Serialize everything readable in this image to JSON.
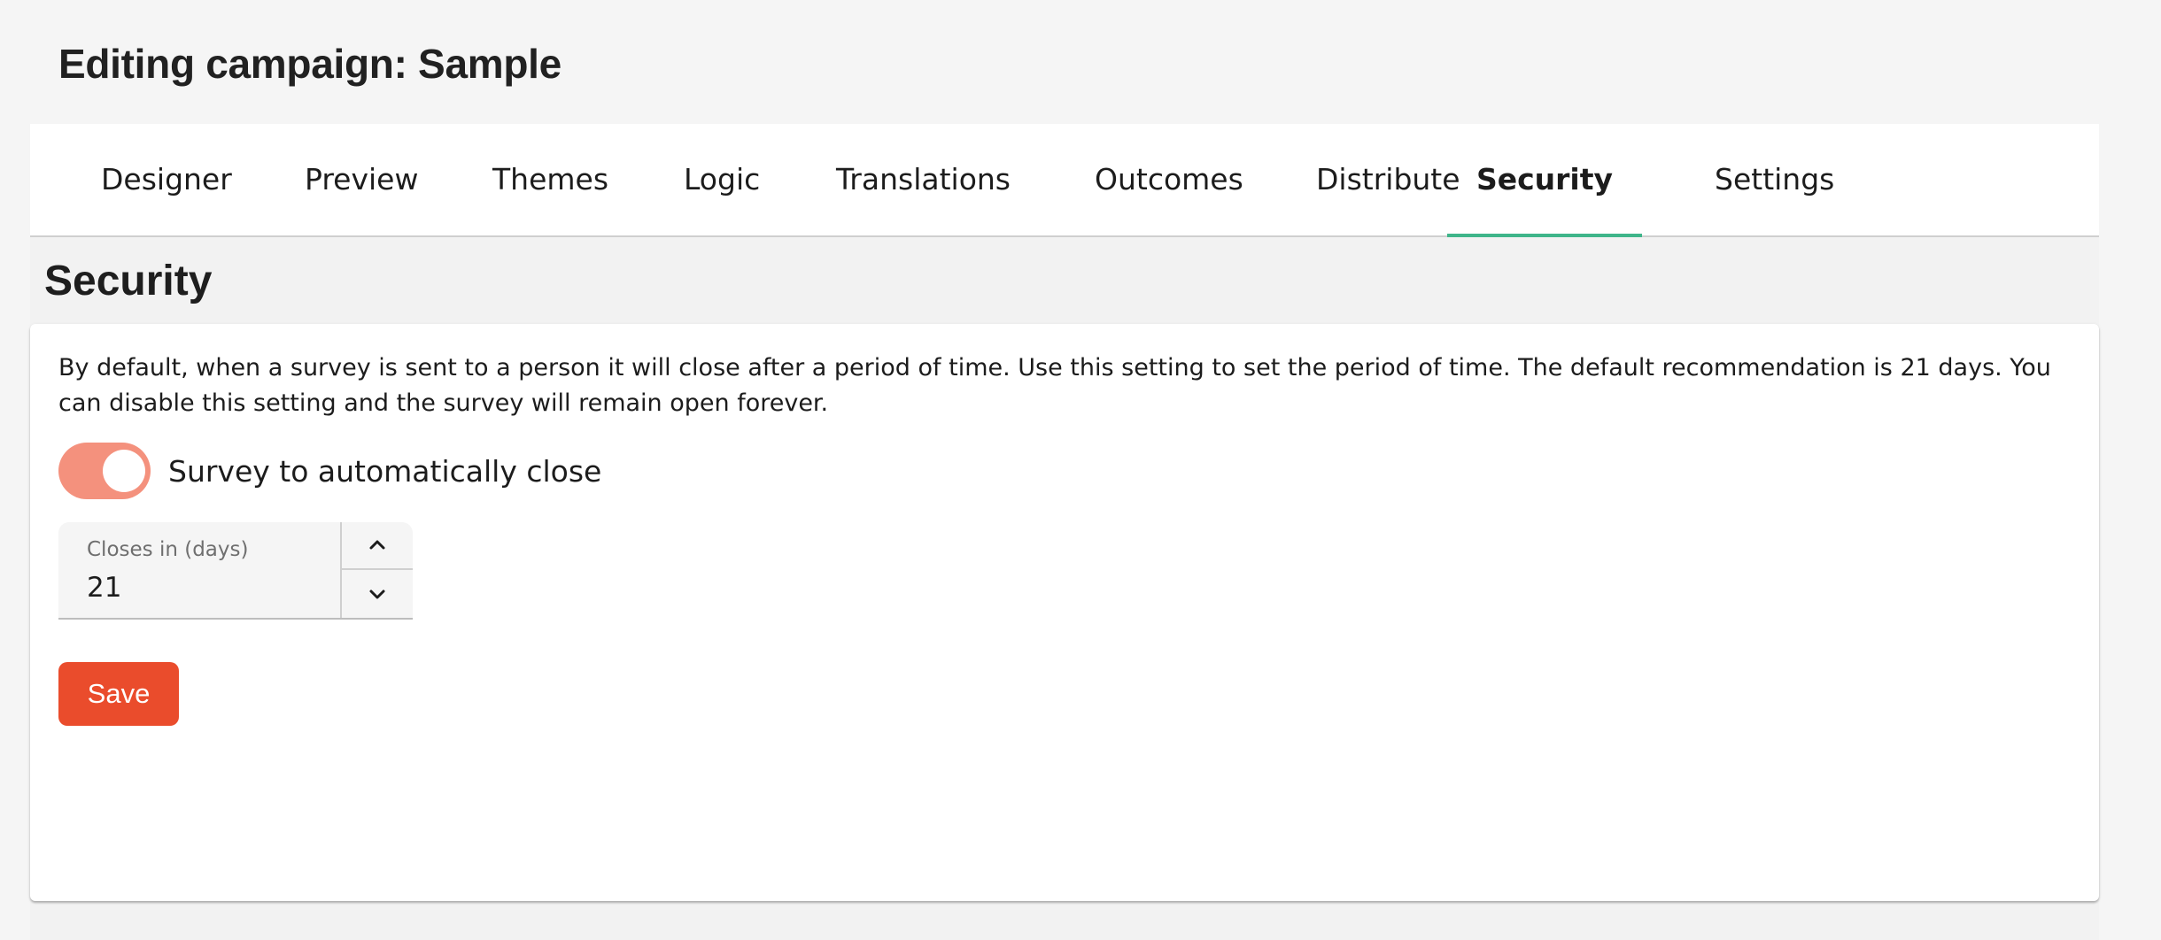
{
  "header": {
    "title": "Editing campaign: Sample"
  },
  "tabs": [
    {
      "label": "Designer",
      "active": false
    },
    {
      "label": "Preview",
      "active": false
    },
    {
      "label": "Themes",
      "active": false
    },
    {
      "label": "Logic",
      "active": false
    },
    {
      "label": "Translations",
      "active": false
    },
    {
      "label": "Outcomes",
      "active": false
    },
    {
      "label": "Distribute",
      "active": false
    },
    {
      "label": "Security",
      "active": true
    },
    {
      "label": "Settings",
      "active": false
    }
  ],
  "security": {
    "title": "Security",
    "description": "By default, when a survey is sent to a person it will close after a period of time. Use this setting to set the period of time. The default recommendation is 21 days. You can disable this setting and the survey will remain open forever.",
    "toggle": {
      "label": "Survey to automatically close",
      "enabled": true
    },
    "closes_in": {
      "label": "Closes in (days)",
      "value": "21",
      "up_icon": "chevron-up-icon",
      "down_icon": "chevron-down-icon"
    },
    "save_label": "Save"
  },
  "colors": {
    "accent_tab_underline": "#3fb58a",
    "toggle_track": "#f4917d",
    "primary_button": "#ea4c2c"
  }
}
